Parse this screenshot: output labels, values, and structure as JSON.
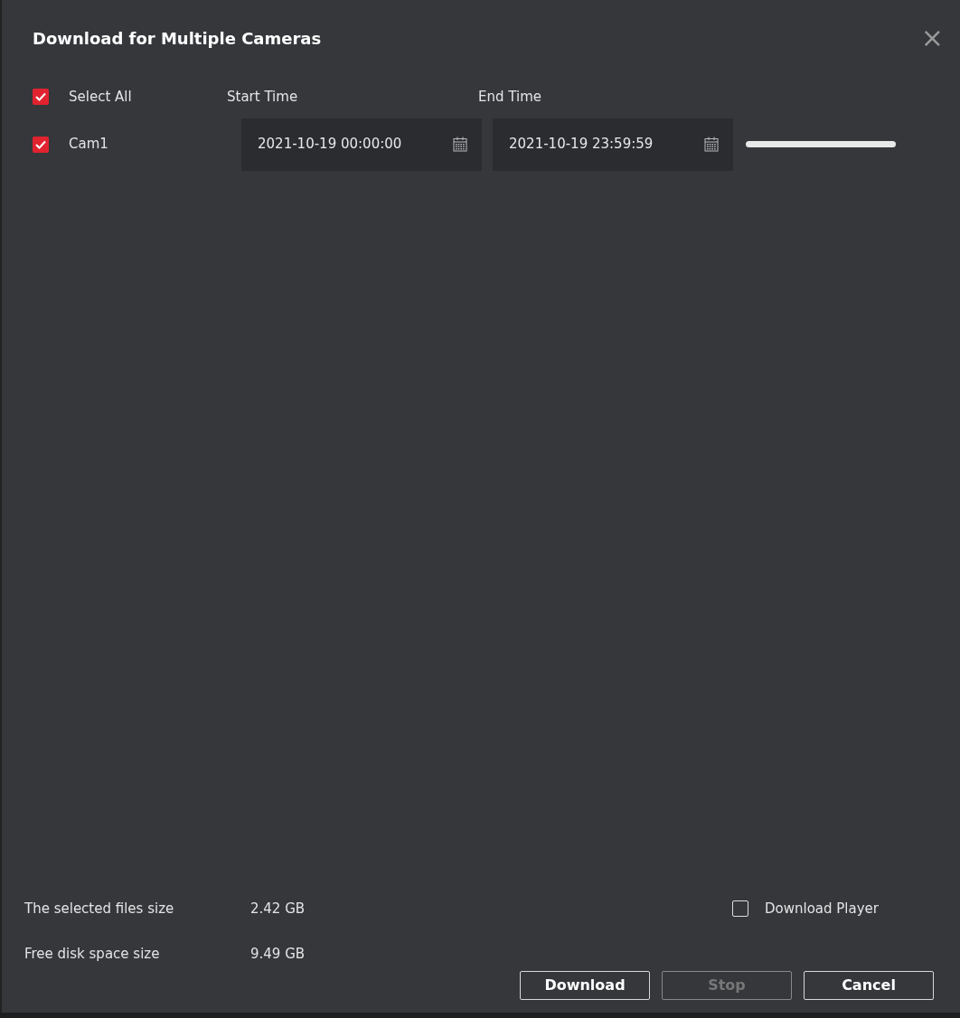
{
  "window": {
    "title": "Download for Multiple Cameras",
    "close": "×"
  },
  "header": {
    "select_all": {
      "label": "Select All",
      "checked": true
    },
    "start_label": "Start Time",
    "end_label": "End Time"
  },
  "cameras": [
    {
      "name": "Cam1",
      "checked": true,
      "start": "2021-10-19 00:00:00",
      "end": "2021-10-19 23:59:59",
      "level": 1
    }
  ],
  "summary": [
    {
      "label": "The selected files size",
      "value": "2.42 GB"
    },
    {
      "label": "Free disk space size",
      "value": "9.49 GB"
    }
  ],
  "download_player": {
    "label": "Download Player",
    "checked": false
  },
  "buttons": [
    {
      "label": "Download",
      "disabled": false
    },
    {
      "label": "Stop",
      "disabled": true
    },
    {
      "label": "Cancel",
      "disabled": false
    }
  ]
}
